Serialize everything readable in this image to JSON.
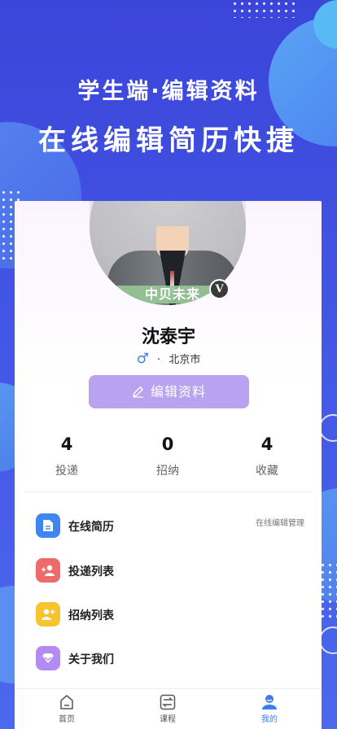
{
  "headline": {
    "line1": "学生端·编辑资料",
    "line2": "在线编辑简历快捷"
  },
  "profile": {
    "avatar_banner": "中贝未来",
    "verified_badge": "V",
    "name": "沈泰宇",
    "gender_symbol": "♂",
    "separator": "·",
    "city": "北京市",
    "edit_button": "编辑资料"
  },
  "stats": [
    {
      "value": "4",
      "label": "投递"
    },
    {
      "value": "0",
      "label": "招纳"
    },
    {
      "value": "4",
      "label": "收藏"
    }
  ],
  "menu": [
    {
      "label": "在线简历",
      "side": "在线编辑管理",
      "icon": "document-icon",
      "color": "#3f86f3"
    },
    {
      "label": "投递列表",
      "side": "",
      "icon": "user-add-icon",
      "color": "#ef6b6b"
    },
    {
      "label": "招纳列表",
      "side": "",
      "icon": "user-plus-icon",
      "color": "#f6c42c"
    },
    {
      "label": "关于我们",
      "side": "",
      "icon": "diamond-icon",
      "color": "#b38cf3"
    }
  ],
  "tabbar": [
    {
      "label": "首页",
      "icon": "home-icon",
      "active": false
    },
    {
      "label": "课程",
      "icon": "swap-icon",
      "active": false
    },
    {
      "label": "我的",
      "icon": "profile-icon",
      "active": true
    }
  ],
  "colors": {
    "background": "#3f4fe2",
    "accent": "#3d7cf0",
    "edit_button": "#b9a2f0"
  }
}
